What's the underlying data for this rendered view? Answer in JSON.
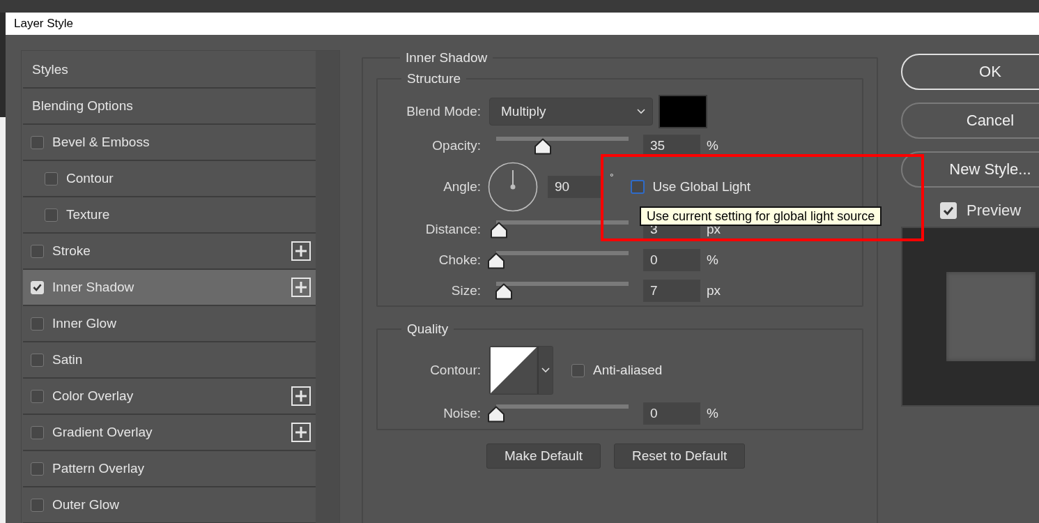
{
  "window": {
    "title": "Layer Style"
  },
  "styles_list": [
    {
      "label": "Styles",
      "kind": "header",
      "selected": false
    },
    {
      "label": "Blending Options",
      "kind": "header",
      "selected": false
    },
    {
      "label": "Bevel & Emboss",
      "kind": "checkbox",
      "checked": false,
      "indented": false,
      "add_button": false,
      "selected": false
    },
    {
      "label": "Contour",
      "kind": "checkbox",
      "checked": false,
      "indented": true,
      "add_button": false,
      "selected": false
    },
    {
      "label": "Texture",
      "kind": "checkbox",
      "checked": false,
      "indented": true,
      "add_button": false,
      "selected": false
    },
    {
      "label": "Stroke",
      "kind": "checkbox",
      "checked": false,
      "indented": false,
      "add_button": true,
      "selected": false
    },
    {
      "label": "Inner Shadow",
      "kind": "checkbox",
      "checked": true,
      "indented": false,
      "add_button": true,
      "selected": true
    },
    {
      "label": "Inner Glow",
      "kind": "checkbox",
      "checked": false,
      "indented": false,
      "add_button": false,
      "selected": false
    },
    {
      "label": "Satin",
      "kind": "checkbox",
      "checked": false,
      "indented": false,
      "add_button": false,
      "selected": false
    },
    {
      "label": "Color Overlay",
      "kind": "checkbox",
      "checked": false,
      "indented": false,
      "add_button": true,
      "selected": false
    },
    {
      "label": "Gradient Overlay",
      "kind": "checkbox",
      "checked": false,
      "indented": false,
      "add_button": true,
      "selected": false
    },
    {
      "label": "Pattern Overlay",
      "kind": "checkbox",
      "checked": false,
      "indented": false,
      "add_button": false,
      "selected": false
    },
    {
      "label": "Outer Glow",
      "kind": "checkbox",
      "checked": false,
      "indented": false,
      "add_button": false,
      "selected": false
    }
  ],
  "effect": {
    "title": "Inner Shadow",
    "structure": {
      "title": "Structure",
      "blend_mode": {
        "label": "Blend Mode:",
        "value": "Multiply"
      },
      "rows": [
        {
          "kind": "slider",
          "label": "Opacity:",
          "value": "35",
          "unit": "%",
          "level": 0.35
        },
        {
          "kind": "angle",
          "label": "Angle:",
          "value": "90",
          "unit": "°",
          "global_light": {
            "label": "Use Global Light",
            "checked": false,
            "focused": true
          }
        },
        {
          "kind": "slider",
          "label": "Distance:",
          "value": "3",
          "unit": "px",
          "level": 0.02
        },
        {
          "kind": "slider",
          "label": "Choke:",
          "value": "0",
          "unit": "%",
          "level": 0
        },
        {
          "kind": "slider",
          "label": "Size:",
          "value": "7",
          "unit": "px",
          "level": 0.06
        }
      ]
    },
    "quality": {
      "title": "Quality",
      "contour": {
        "label": "Contour:"
      },
      "anti_aliased": {
        "label": "Anti-aliased",
        "checked": false
      },
      "noise": {
        "label": "Noise:",
        "value": "0",
        "unit": "%",
        "level": 0
      }
    },
    "buttons": [
      "Make Default",
      "Reset to Default"
    ]
  },
  "tooltip": "Use current setting for global light source",
  "side_buttons": [
    {
      "label": "OK",
      "default": true
    },
    {
      "label": "Cancel",
      "default": false
    },
    {
      "label": "New Style...",
      "default": false
    }
  ],
  "preview": {
    "label": "Preview",
    "checked": true
  }
}
